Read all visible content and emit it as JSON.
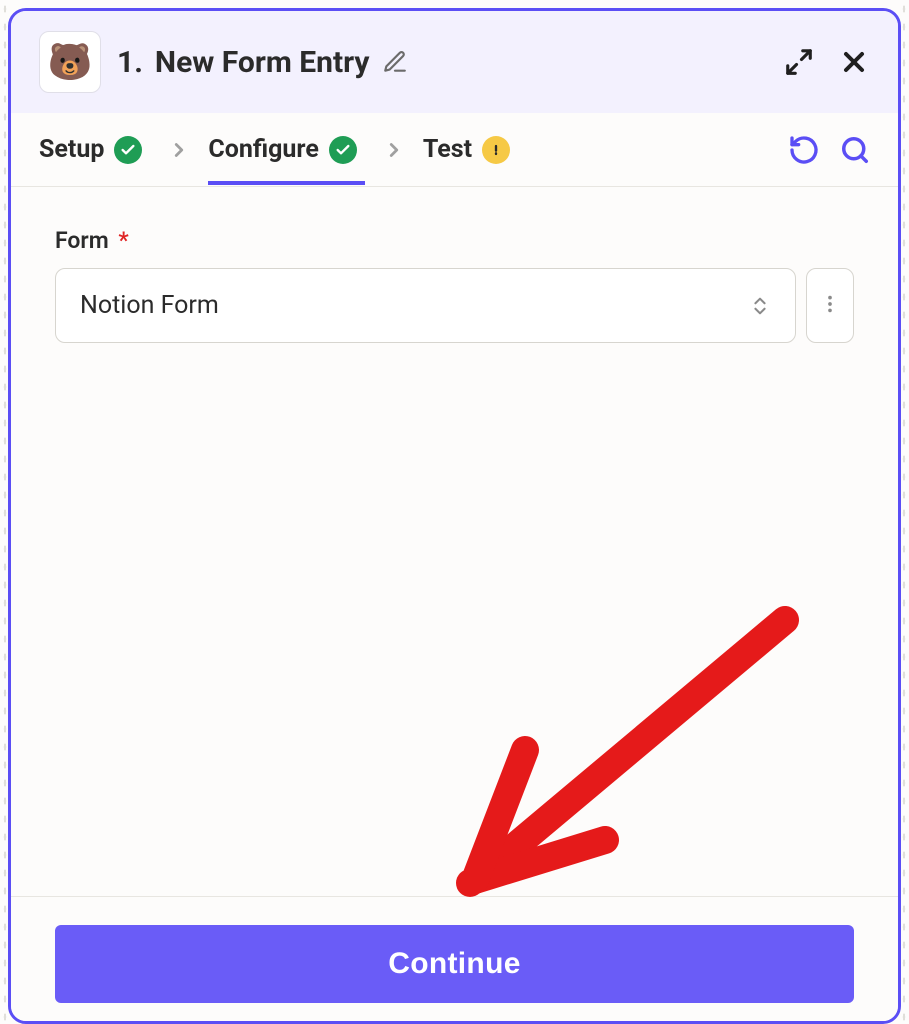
{
  "header": {
    "step_number": "1.",
    "title": "New Form Entry",
    "app_icon_emoji": "🐻"
  },
  "tabs": {
    "items": [
      {
        "label": "Setup",
        "status": "success"
      },
      {
        "label": "Configure",
        "status": "success"
      },
      {
        "label": "Test",
        "status": "warn"
      }
    ],
    "active_index": 1
  },
  "form": {
    "field_label": "Form",
    "required_mark": "*",
    "selected_value": "Notion Form"
  },
  "footer": {
    "continue_label": "Continue"
  },
  "icons": {
    "edit": "pencil-icon",
    "expand": "expand-icon",
    "close": "close-icon",
    "undo": "undo-icon",
    "search": "search-icon",
    "chevron_right": "chevron-right-icon",
    "select_caret": "select-caret-icon",
    "more": "more-vertical-icon",
    "check": "check-icon",
    "exclaim": "exclamation-icon"
  },
  "colors": {
    "accent": "#5b4ef5",
    "button": "#6a5cf7",
    "success": "#1f9d55",
    "warn": "#f6c945",
    "annotation": "#e51a1a"
  }
}
